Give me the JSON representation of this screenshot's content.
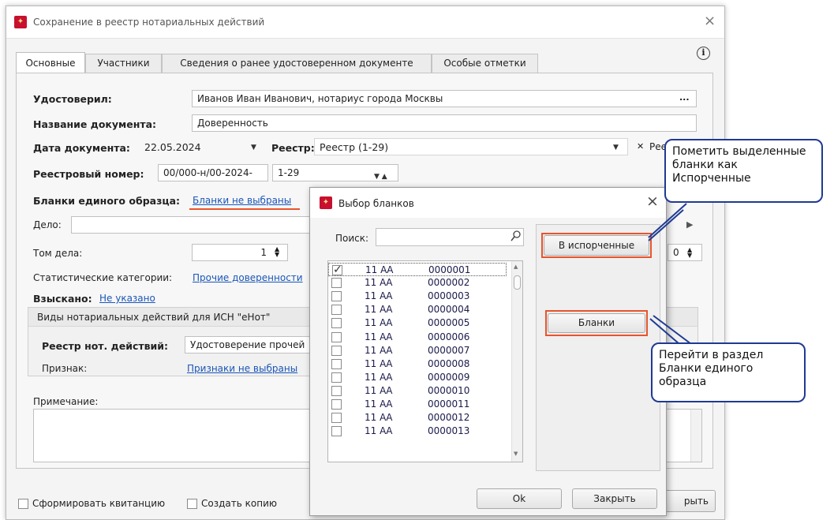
{
  "window": {
    "title": "Сохранение в реестр нотариальных действий",
    "close_glyph": "×",
    "info_glyph": "i"
  },
  "tabs": [
    {
      "label": "Основные"
    },
    {
      "label": "Участники"
    },
    {
      "label": "Сведения о ранее удостоверенном документе"
    },
    {
      "label": "Особые отметки"
    }
  ],
  "form": {
    "certified_label": "Удостоверил:",
    "certified_value": "Иванов Иван Иванович, нотариус города Москвы",
    "ellipsis": "...",
    "doc_name_label": "Название документа:",
    "doc_name_value": "Доверенность",
    "doc_date_label": "Дата документа:",
    "doc_date_value": "22.05.2024",
    "registry_label": "Реестр:",
    "registry_value": "Реестр (1-29)",
    "registry_clear": "✕",
    "registry_extra": "Рее",
    "reg_number_label": "Реестровый номер:",
    "reg_number_value": "00/000-н/00-2024-",
    "reg_number_range": "1-29",
    "blanks_label": "Бланки единого образца:",
    "blanks_link": "Бланки не выбраны",
    "case_label": "Дело:",
    "volume_label": "Том дела:",
    "volume_value": "1",
    "volume_right_value": "0",
    "stat_label": "Статистические категории:",
    "stat_link": "Прочие доверенности",
    "collected_label": "Взыскано:",
    "collected_link": "Не указано",
    "ehot_group_title": "Виды нотариальных действий для ИСН \"еНот\"",
    "registry_actions_label": "Реестр нот. действий:",
    "registry_actions_value": "Удостоверение прочей",
    "sign_label": "Признак:",
    "sign_link": "Признаки не выбраны",
    "note_label": "Примечание:"
  },
  "bottom": {
    "receipt_checkbox": "Сформировать квитанцию",
    "copy_checkbox": "Создать копию",
    "close_partial": "рыть"
  },
  "dialog": {
    "title": "Выбор бланков",
    "close_glyph": "×",
    "search_label": "Поиск:",
    "search_value": "",
    "rows": [
      {
        "series": "11 АА",
        "number": "0000001",
        "checked": true
      },
      {
        "series": "11 АА",
        "number": "0000002",
        "checked": false
      },
      {
        "series": "11 АА",
        "number": "0000003",
        "checked": false
      },
      {
        "series": "11 АА",
        "number": "0000004",
        "checked": false
      },
      {
        "series": "11 АА",
        "number": "0000005",
        "checked": false
      },
      {
        "series": "11 АА",
        "number": "0000006",
        "checked": false
      },
      {
        "series": "11 АА",
        "number": "0000007",
        "checked": false
      },
      {
        "series": "11 АА",
        "number": "0000008",
        "checked": false
      },
      {
        "series": "11 АА",
        "number": "0000009",
        "checked": false
      },
      {
        "series": "11 АА",
        "number": "0000010",
        "checked": false
      },
      {
        "series": "11 АА",
        "number": "0000011",
        "checked": false
      },
      {
        "series": "11 АА",
        "number": "0000012",
        "checked": false
      },
      {
        "series": "11 АА",
        "number": "0000013",
        "checked": false
      }
    ],
    "spoiled_button": "В испорченные",
    "blanks_button": "Бланки",
    "ok_button": "Ok",
    "close_button": "Закрыть"
  },
  "callouts": {
    "mark_spoiled": "Пометить выделенные бланки как Испорченные",
    "go_blanks": "Перейти в раздел Бланки единого образца"
  },
  "colors": {
    "highlight": "#e8542c",
    "callout_border": "#1f3a93",
    "link": "#1a56b8",
    "app_icon": "#c8102e"
  }
}
